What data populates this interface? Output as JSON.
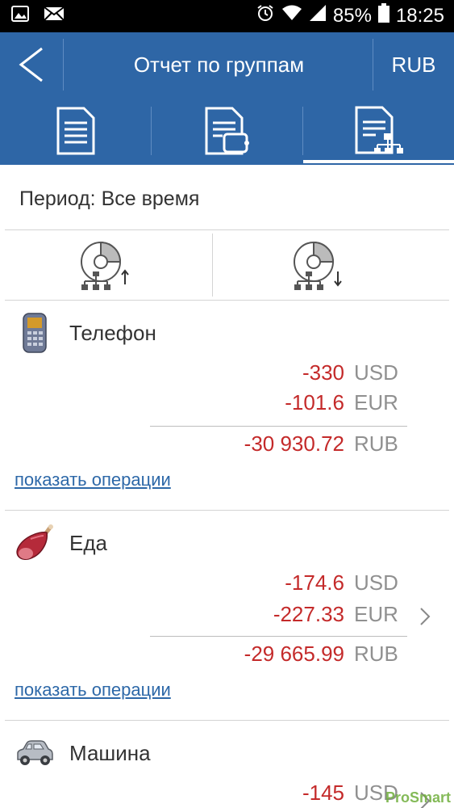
{
  "status_bar": {
    "battery": "85%",
    "time": "18:25"
  },
  "app_bar": {
    "title": "Отчет по группам",
    "currency": "RUB"
  },
  "tabs": [
    {
      "name": "document-report-icon"
    },
    {
      "name": "document-wallet-icon"
    },
    {
      "name": "document-groups-icon",
      "selected": true
    }
  ],
  "period": "Период: Все время",
  "sort_buttons": [
    {
      "name": "sort-ascending-icon"
    },
    {
      "name": "sort-descending-icon"
    }
  ],
  "groups": [
    {
      "name": "Телефон",
      "icon": "phone-icon",
      "amounts": [
        {
          "value": "-330",
          "currency": "USD"
        },
        {
          "value": "-101.6",
          "currency": "EUR"
        }
      ],
      "total": {
        "value": "-30 930.72",
        "currency": "RUB"
      },
      "link": "показать операции"
    },
    {
      "name": "Еда",
      "icon": "ham-icon",
      "amounts": [
        {
          "value": "-174.6",
          "currency": "USD"
        },
        {
          "value": "-227.33",
          "currency": "EUR"
        }
      ],
      "total": {
        "value": "-29 665.99",
        "currency": "RUB"
      },
      "link": "показать операции"
    },
    {
      "name": "Машина",
      "icon": "car-icon",
      "amounts": [
        {
          "value": "-145",
          "currency": "USD"
        }
      ]
    }
  ],
  "watermark": "ProSmart",
  "colors": {
    "header_blue": "#2e66a6",
    "negative_red": "#c42a2a",
    "link_blue": "#2d68a8"
  }
}
